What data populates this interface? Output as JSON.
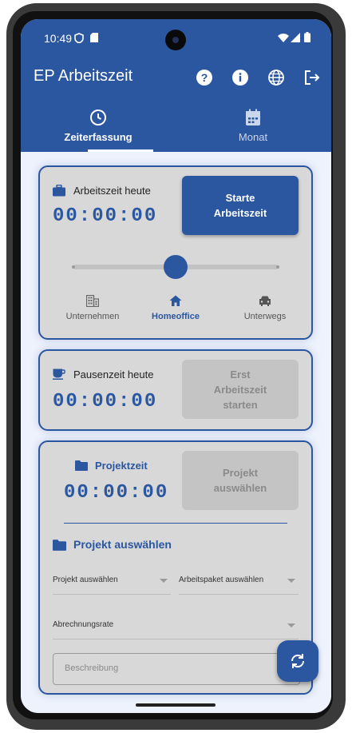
{
  "status_bar": {
    "time": "10:49"
  },
  "app_bar": {
    "title": "EP Arbeitszeit",
    "icons": [
      "help-icon",
      "info-icon",
      "globe-icon",
      "logout-icon"
    ]
  },
  "tabs": [
    {
      "label": "Zeiterfassung",
      "icon": "clock-icon",
      "selected": true
    },
    {
      "label": "Monat",
      "icon": "calendar-icon",
      "selected": false
    }
  ],
  "work_card": {
    "label": "Arbeitszeit heute",
    "timer": "00:00:00",
    "start_button": "Starte\nArbeitszeit",
    "modes": [
      {
        "label": "Unternehmen",
        "icon": "building-icon"
      },
      {
        "label": "Homeoffice",
        "icon": "home-icon"
      },
      {
        "label": "Unterwegs",
        "icon": "car-icon"
      }
    ],
    "selected_mode": "Homeoffice"
  },
  "pause_card": {
    "label": "Pausenzeit heute",
    "timer": "00:00:00",
    "button": "Erst\nArbeitszeit\nstarten"
  },
  "project_card": {
    "label": "Projektzeit",
    "timer": "00:00:00",
    "button": "Projekt\nauswählen",
    "section_title": "Projekt auswählen",
    "project_select_placeholder": "Projekt auswählen",
    "package_select_placeholder": "Arbeitspaket auswählen",
    "rate_select_placeholder": "Abrechnungsrate",
    "description_placeholder": "Beschreibung"
  },
  "colors": {
    "primary": "#2b56a0",
    "card_bg": "#d8d8d8",
    "disabled": "#c4c4c4"
  }
}
